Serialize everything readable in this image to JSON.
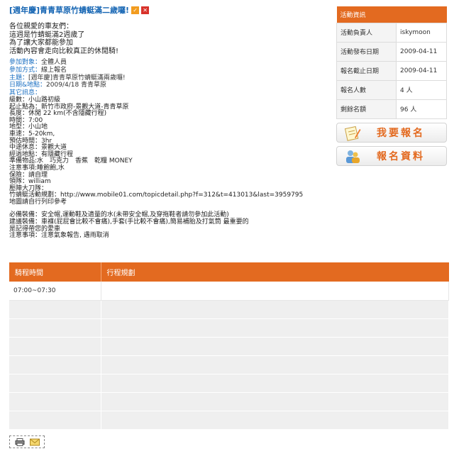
{
  "header": {
    "title": "[週年慶]青青草原竹蜻蜓滿二歲囉!",
    "edit_icon": "checkmark-icon",
    "delete_icon": "close-icon"
  },
  "intro": {
    "lines": [
      "各位親愛的車友們：",
      "這週是竹蜻蜓滿2週歲了",
      "為了讓大家都能參加",
      "活動內容會走向比較真正的休閒騎!"
    ]
  },
  "fields": {
    "target_label": "參加對象：",
    "target_value": "全體人員",
    "method_label": "參加方式：",
    "method_value": "線上報名",
    "topic_label": "主題：",
    "topic_value": "[週年慶]青青草原竹蜻蜓滿兩歲囉!",
    "date_label": "日期&地點：",
    "date_value": "2009/4/18 青青草原",
    "other_label": "其它訊息："
  },
  "details": {
    "lines": [
      "級數：小山路初級",
      "起止點為：新竹市政府-景觀大道-青青草原",
      "長度：休閒 22 km(不含隱藏行程)",
      "時間：7:00",
      "地型：小山地",
      "車速：5-20km,",
      "預估時間：3hr",
      "中途休息：景觀大道",
      "經過地點：有隱藏行程",
      "準備物品:水　巧克力　香蕉　乾糧 MONEY",
      "注意事項:睡飽飽,水",
      "保險：請自理",
      "領隊：william",
      "壓陣大刀隊：",
      "竹蜻蜓活動規劃：http://www.mobile01.com/topicdetail.php?f=312&t=413013&last=3959795",
      "地圖請自行列印參考"
    ],
    "lines2": [
      "必備裝備：安全帽,運動鞋及適量的水(未帶安全帽,及穿拖鞋者請勿參加此活動)",
      "建議裝備：車褲(屁屁會比較不會痛),手套(手比較不會痛),簡易補胎及打氣筒 最重要的",
      "是記得帶您的愛車",
      "注意事項：注意氣象報告, 遇雨取消"
    ]
  },
  "schedule": {
    "headers": [
      "騎程時間",
      "行程規劃"
    ],
    "rows": [
      [
        "07:00~07:30",
        ""
      ],
      [
        "",
        ""
      ],
      [
        "",
        ""
      ],
      [
        "",
        ""
      ],
      [
        "",
        ""
      ],
      [
        "",
        ""
      ],
      [
        "",
        ""
      ],
      [
        "",
        ""
      ]
    ]
  },
  "panel": {
    "title": "活動資訊",
    "rows": [
      {
        "k": "活動負責人",
        "v": "iskymoon"
      },
      {
        "k": "活動發布日期",
        "v": "2009-04-11"
      },
      {
        "k": "報名截止日期",
        "v": "2009-04-11"
      },
      {
        "k": "報名人數",
        "v": "4 人"
      },
      {
        "k": "剩餘名額",
        "v": "96 人"
      }
    ]
  },
  "buttons": {
    "signup_label": "我要報名",
    "signup_icon": "notepad-icon",
    "info_label": "報名資料",
    "info_icon": "users-icon"
  },
  "tools": {
    "print_icon": "printer-icon",
    "mail_icon": "envelope-icon"
  },
  "colors": {
    "accent": "#e36a20",
    "link": "#1565b3"
  }
}
